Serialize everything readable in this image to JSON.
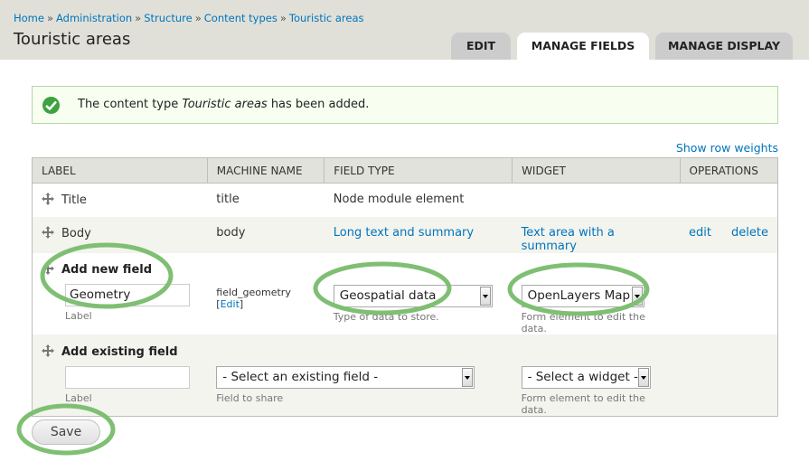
{
  "breadcrumb": {
    "items": [
      "Home",
      "Administration",
      "Structure",
      "Content types",
      "Touristic areas"
    ],
    "separator": "»"
  },
  "page_title": "Touristic areas",
  "tabs": {
    "edit": "EDIT",
    "manage_fields": "MANAGE FIELDS",
    "manage_display": "MANAGE DISPLAY"
  },
  "message": {
    "before": "The content type ",
    "emphasis": "Touristic areas",
    "after": " has been added."
  },
  "show_row_weights": "Show row weights",
  "table": {
    "headers": {
      "label": "LABEL",
      "machine_name": "MACHINE NAME",
      "field_type": "FIELD TYPE",
      "widget": "WIDGET",
      "operations": "OPERATIONS"
    },
    "rows": {
      "title": {
        "label": "Title",
        "machine_name": "title",
        "field_type": "Node module element"
      },
      "body": {
        "label": "Body",
        "machine_name": "body",
        "field_type": "Long text and summary",
        "widget": "Text area with a summary",
        "edit": "edit",
        "delete": "delete"
      },
      "add_new": {
        "heading": "Add new field",
        "label_value": "Geometry",
        "label_desc": "Label",
        "machine_name": "field_geometry",
        "machine_edit_open": "[",
        "machine_edit": "Edit",
        "machine_edit_close": "]",
        "field_type_value": "Geospatial data",
        "field_type_desc": "Type of data to store.",
        "widget_value": "OpenLayers Map",
        "widget_desc": "Form element to edit the data."
      },
      "add_existing": {
        "heading": "Add existing field",
        "label_value": "",
        "label_desc": "Label",
        "field_value": "- Select an existing field -",
        "field_desc": "Field to share",
        "widget_value": "- Select a widget -",
        "widget_desc": "Form element to edit the data."
      }
    }
  },
  "save_label": "Save",
  "colors": {
    "link": "#0074bd",
    "header_bg": "#e0e0d8",
    "highlight_circle": "#7fbf73",
    "success": "#3ea23e"
  }
}
